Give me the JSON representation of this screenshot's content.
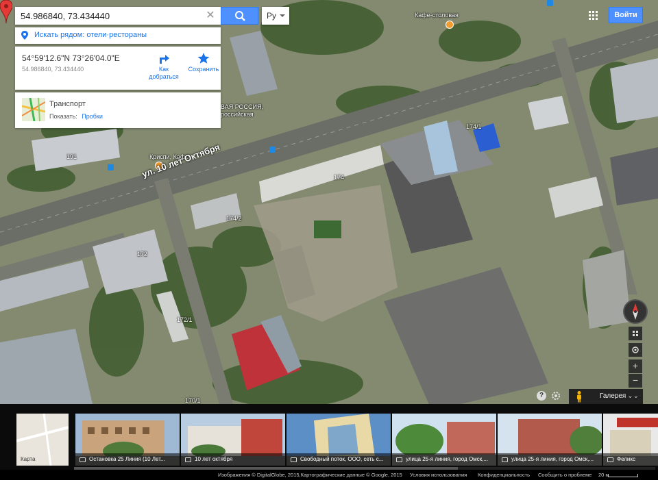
{
  "search": {
    "value": "54.986840, 73.434440",
    "language": "Ру"
  },
  "nearby": {
    "label": "Искать рядом: отели·рестораны"
  },
  "coord_card": {
    "dms": "54°59'12.6\"N 73°26'04.0\"E",
    "decimal": "54.986840, 73.434440",
    "directions_label_1": "Как",
    "directions_label_2": "добраться",
    "save_label": "Сохранить"
  },
  "transport": {
    "title": "Транспорт",
    "show_prefix": "Показать:",
    "show_link": "Пробки"
  },
  "header": {
    "login_label": "Войти"
  },
  "map_labels": {
    "cafe_top": "Кафе-столовая",
    "cafe_krispi": "Криспи, Кафе",
    "road": "ул. 10 лет Октября",
    "bank_line1": "ВАЯ РОССИЯ,",
    "bank_line2": "российская",
    "b191": "191",
    "b174": "174",
    "b1741": "174/1",
    "b1742": "174/2",
    "b172": "172",
    "b1722": "172/1",
    "b1701": "170/1"
  },
  "controls": {
    "zoom_in": "+",
    "zoom_out": "−",
    "help": "?",
    "gallery_label": "Галерея"
  },
  "gallery": {
    "tiles": [
      {
        "caption": "Карта"
      },
      {
        "caption": "Остановка 25 Линия (10 Лет..."
      },
      {
        "caption": "10 лет октября"
      },
      {
        "caption": "Свободный поток, ООО, сеть с..."
      },
      {
        "caption": "улица 25-я линия, город Омск,..."
      },
      {
        "caption": "улица 25-я линия, город Омск,..."
      },
      {
        "caption": "Феликс"
      }
    ]
  },
  "footer": {
    "imagery": "Изображения © DigitalGlobe, 2015,Картографические данные © Google, 2015",
    "terms": "Условия использования",
    "privacy": "Конфиденциальность",
    "report": "Сообщить о проблеме",
    "scale": "20 м"
  }
}
